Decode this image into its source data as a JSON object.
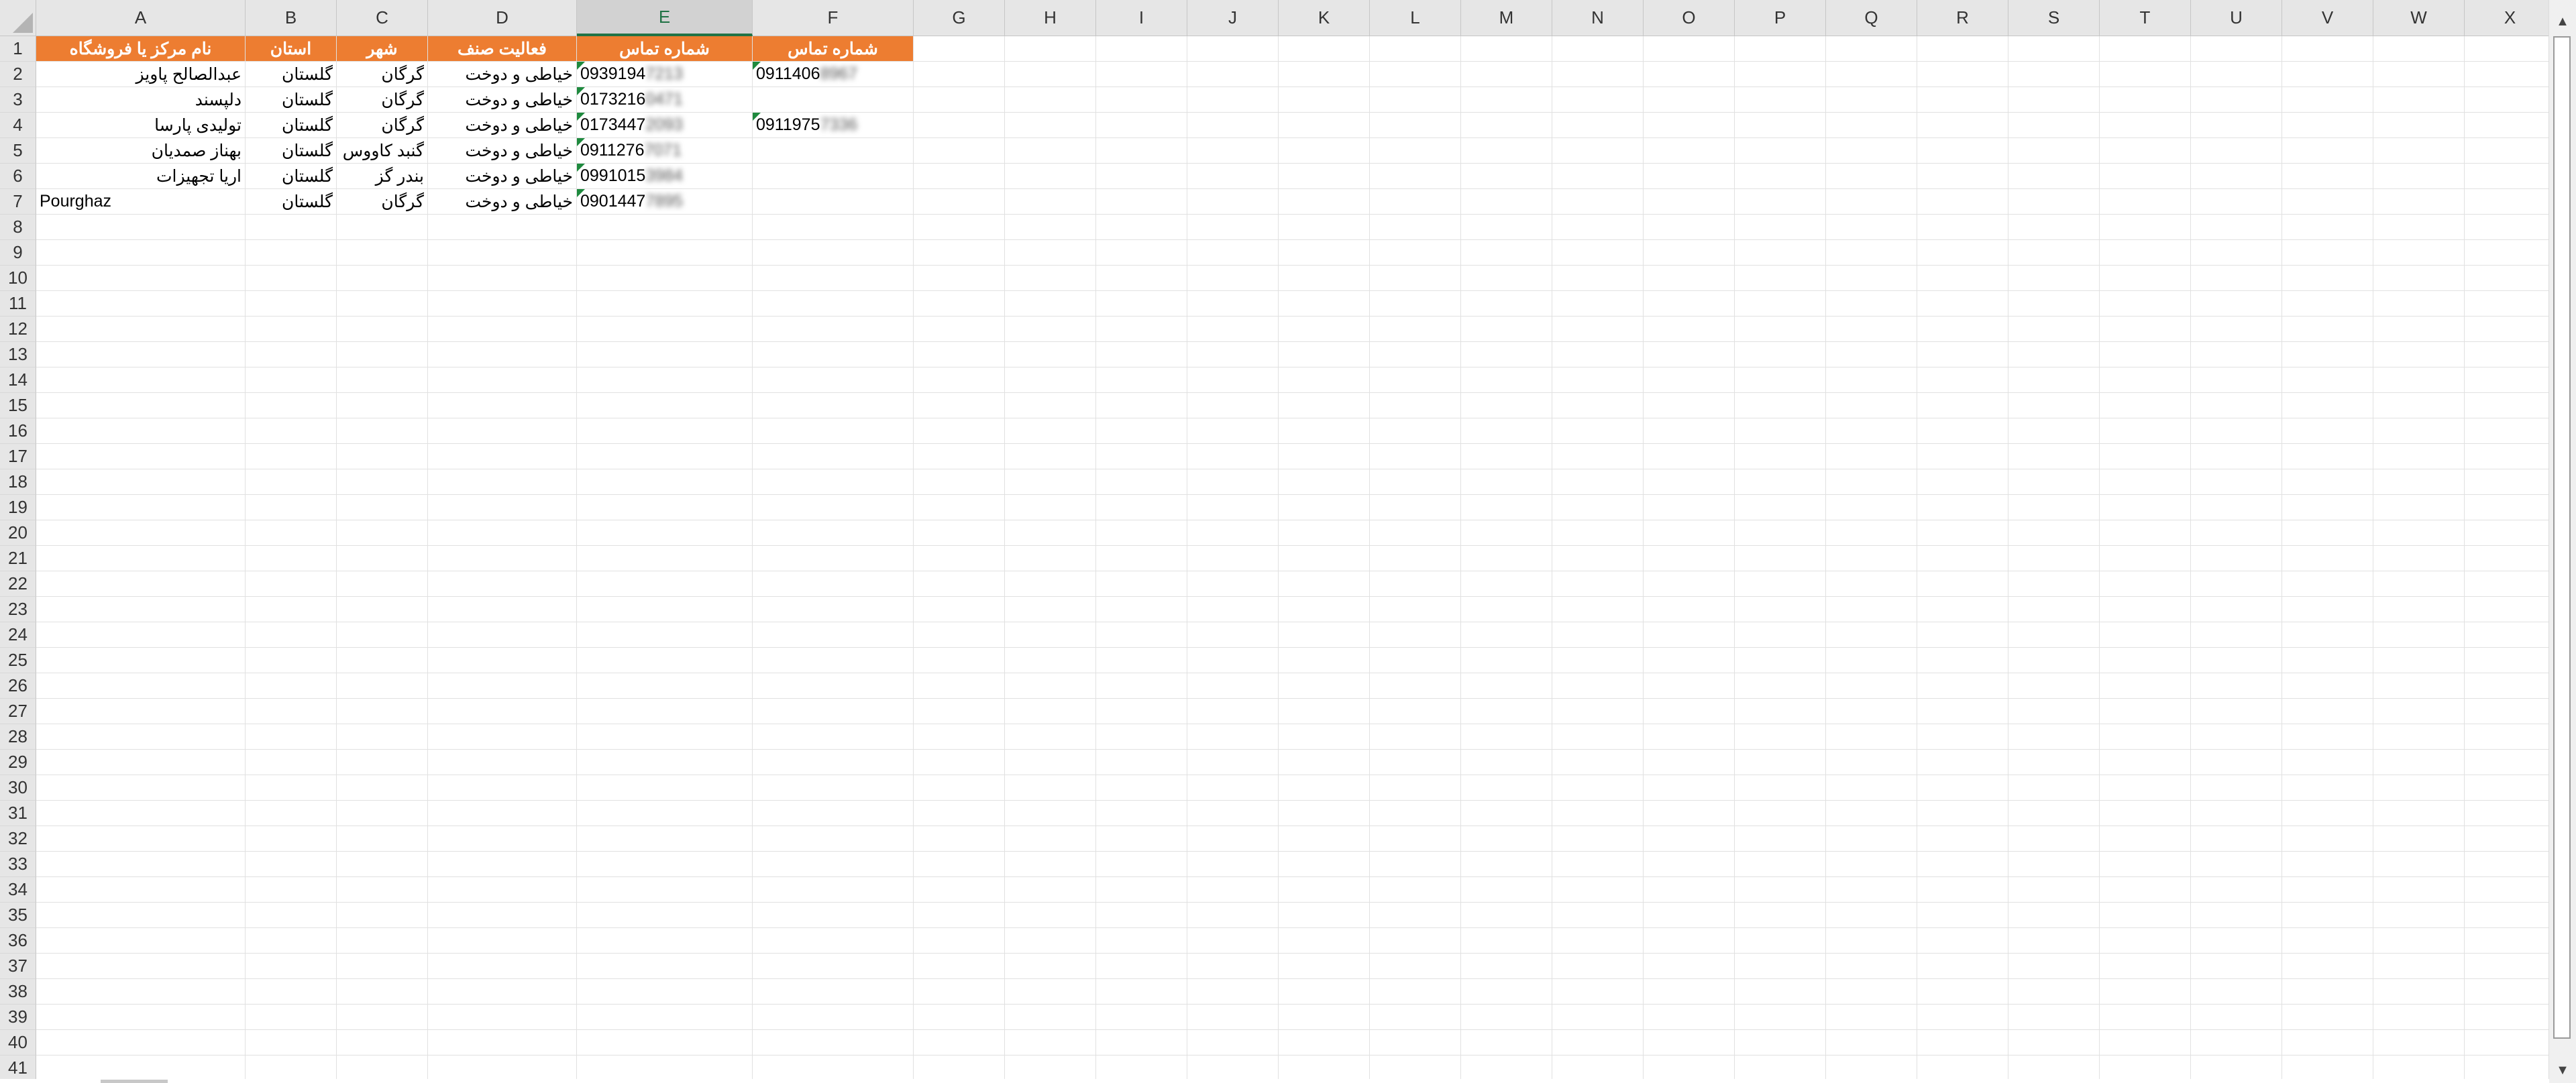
{
  "columns": [
    "A",
    "B",
    "C",
    "D",
    "E",
    "F",
    "G",
    "H",
    "I",
    "J",
    "K",
    "L",
    "M",
    "N",
    "O",
    "P",
    "Q",
    "R",
    "S",
    "T",
    "U",
    "V",
    "W",
    "X"
  ],
  "active_column": "E",
  "rows": [
    "1",
    "2",
    "3",
    "4",
    "5",
    "6",
    "7",
    "8",
    "9",
    "10",
    "11",
    "12",
    "13",
    "14",
    "15",
    "16",
    "17",
    "18",
    "19",
    "20",
    "21",
    "22",
    "23",
    "24",
    "25",
    "26",
    "27",
    "28",
    "29",
    "30",
    "31",
    "32",
    "33",
    "34",
    "35",
    "36",
    "37",
    "38",
    "39",
    "40",
    "41"
  ],
  "header_row": {
    "A": "نام مرکز یا فروشگاه",
    "B": "استان",
    "C": "شهر",
    "D": "فعالیت صنف",
    "E": "شماره تماس",
    "F": "شماره تماس"
  },
  "data_rows": [
    {
      "A": "عبدالصالح پاویز",
      "B": "گلستان",
      "C": "گرگان",
      "D": "خیاطی و دوخت",
      "E": "0939194",
      "E_hidden": "7213",
      "F": "0911406",
      "F_hidden": "8967"
    },
    {
      "A": "دلپسند",
      "B": "گلستان",
      "C": "گرگان",
      "D": "خیاطی و دوخت",
      "E": "0173216",
      "E_hidden": "0471",
      "F": "",
      "F_hidden": ""
    },
    {
      "A": "تولیدی پارسا",
      "B": "گلستان",
      "C": "گرگان",
      "D": "خیاطی و دوخت",
      "E": "0173447",
      "E_hidden": "2093",
      "F": "0911975",
      "F_hidden": "7336"
    },
    {
      "A": "بهناز صمدیان",
      "B": "گلستان",
      "C": "گنبد کاووس",
      "D": "خیاطی و دوخت",
      "E": "0911276",
      "E_hidden": "7071",
      "F": "",
      "F_hidden": ""
    },
    {
      "A": "اریا تجهیزات",
      "B": "گلستان",
      "C": "بندر گز",
      "D": "خیاطی و دوخت",
      "E": "0991015",
      "E_hidden": "3984",
      "F": "",
      "F_hidden": ""
    },
    {
      "A": "Pourghaz",
      "B": "گلستان",
      "C": "گرگان",
      "D": "خیاطی و دوخت",
      "E": "0901447",
      "E_hidden": "7895",
      "F": "",
      "F_hidden": ""
    }
  ],
  "colors": {
    "header_fill": "#ed7d31",
    "header_text": "#ffffff",
    "active_col": "#217346",
    "error_marker": "#1e8a3e"
  },
  "icons": {
    "scroll_up": "▲",
    "scroll_down": "▼"
  }
}
